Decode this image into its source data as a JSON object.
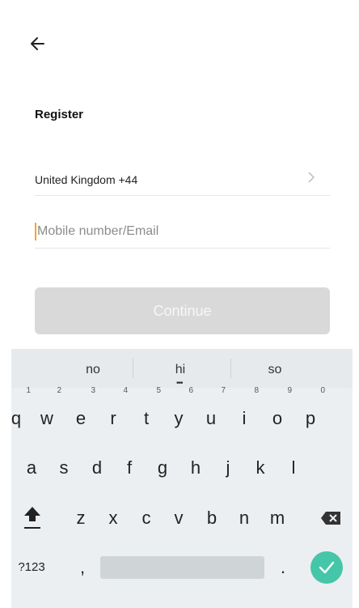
{
  "header": {
    "back_icon": "arrow-left-icon"
  },
  "title": "Register",
  "country": {
    "label": "United Kingdom +44",
    "chevron_icon": "chevron-right-icon"
  },
  "input": {
    "placeholder": "Mobile number/Email",
    "value": ""
  },
  "continue_label": "Continue",
  "keyboard": {
    "suggestions": [
      "no",
      "hi",
      "so"
    ],
    "row1": [
      {
        "key": "q",
        "hint": "1"
      },
      {
        "key": "w",
        "hint": "2"
      },
      {
        "key": "e",
        "hint": "3"
      },
      {
        "key": "r",
        "hint": "4"
      },
      {
        "key": "t",
        "hint": "5"
      },
      {
        "key": "y",
        "hint": "6"
      },
      {
        "key": "u",
        "hint": "7"
      },
      {
        "key": "i",
        "hint": "8"
      },
      {
        "key": "o",
        "hint": "9"
      },
      {
        "key": "p",
        "hint": "0"
      }
    ],
    "row2": [
      "a",
      "s",
      "d",
      "f",
      "g",
      "h",
      "j",
      "k",
      "l"
    ],
    "row3": [
      "z",
      "x",
      "c",
      "v",
      "b",
      "n",
      "m"
    ],
    "bottom": {
      "symbols": "?123",
      "comma": ",",
      "period": "."
    },
    "icons": {
      "shift": "shift-icon",
      "backspace": "backspace-icon",
      "enter": "checkmark-icon"
    },
    "accent_color": "#46c6a8"
  },
  "colors": {
    "caret": "#f5a623",
    "button_disabled": "#d9d9d9"
  }
}
